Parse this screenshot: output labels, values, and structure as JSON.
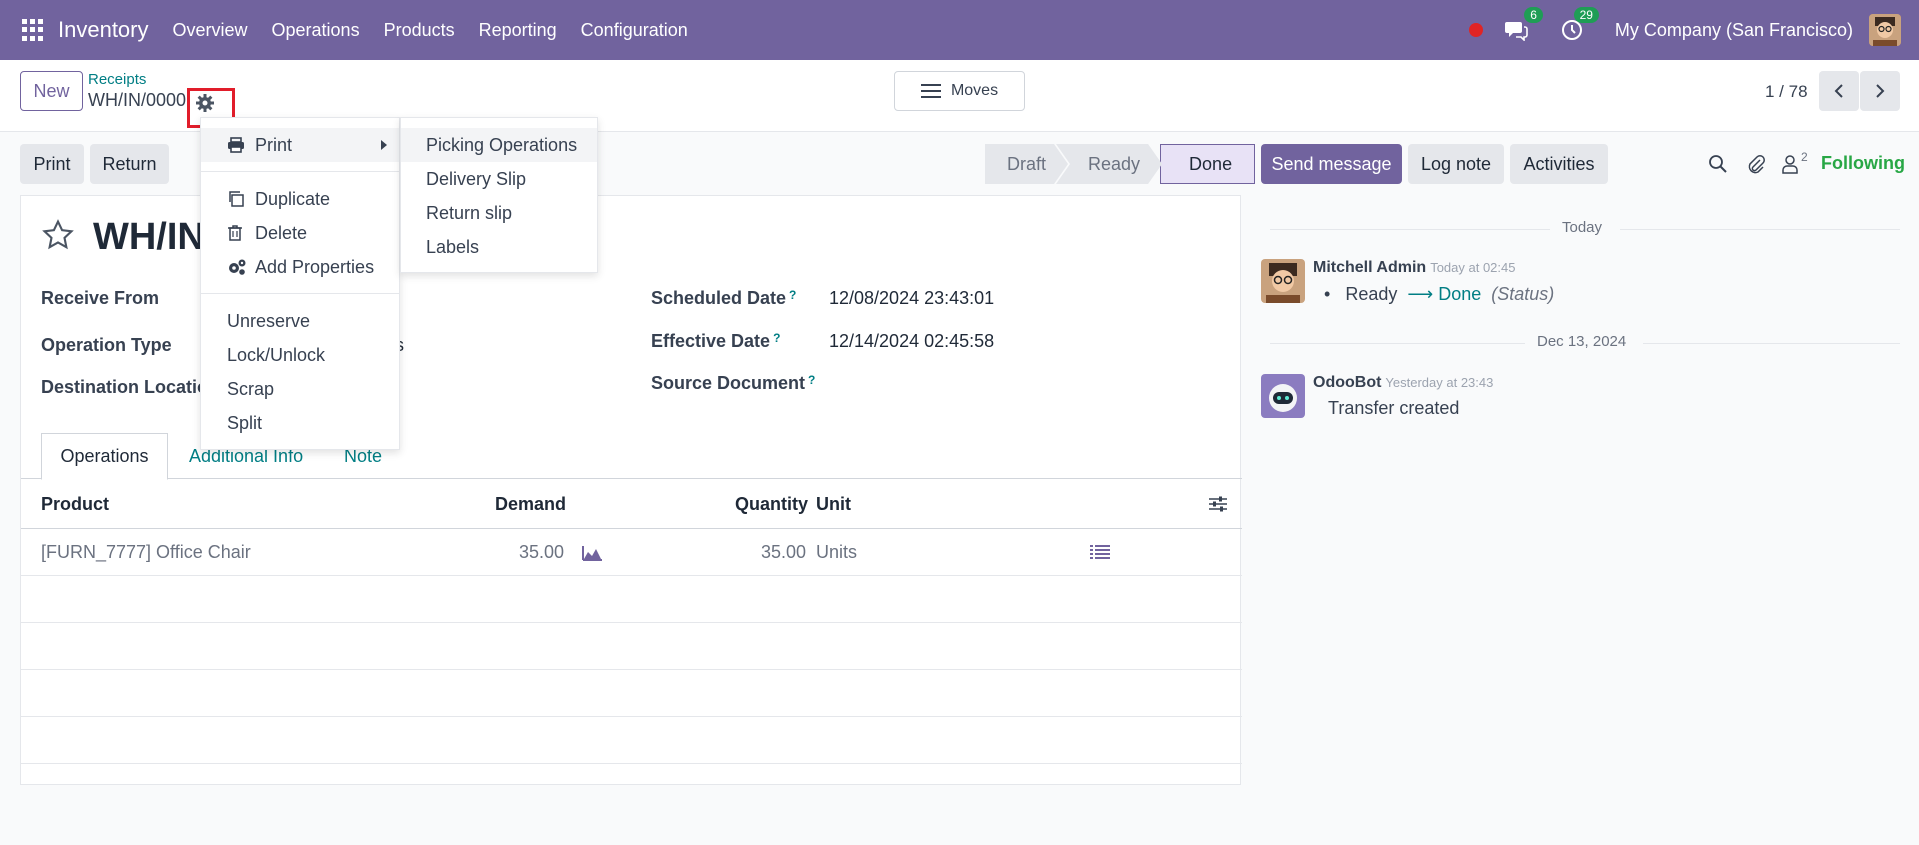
{
  "navbar": {
    "brand": "Inventory",
    "menu": [
      "Overview",
      "Operations",
      "Products",
      "Reporting",
      "Configuration"
    ],
    "chat_badge": "6",
    "activity_badge": "29",
    "company": "My Company (San Francisco)"
  },
  "control": {
    "new_label": "New",
    "breadcrumb_parent": "Receipts",
    "breadcrumb_current": "WH/IN/0000",
    "moves_label": "Moves",
    "pager": "1 / 78"
  },
  "actions": {
    "print": "Print",
    "return": "Return"
  },
  "status": {
    "steps": [
      "Draft",
      "Ready",
      "Done"
    ],
    "active": "Done"
  },
  "form": {
    "title": "WH/IN",
    "receive_from_label": "Receive From",
    "operation_type_label": "Operation Type",
    "operation_type_value_tail": "s",
    "destination_label": "Destination Locatior",
    "scheduled_date_label": "Scheduled Date",
    "scheduled_date_value": "12/08/2024 23:43:01",
    "effective_date_label": "Effective Date",
    "effective_date_value": "12/14/2024 02:45:58",
    "source_document_label": "Source Document",
    "help_mark": "?"
  },
  "tabs": [
    "Operations",
    "Additional Info",
    "Note"
  ],
  "table": {
    "headers": {
      "product": "Product",
      "demand": "Demand",
      "quantity": "Quantity",
      "unit": "Unit"
    },
    "rows": [
      {
        "product": "[FURN_7777] Office Chair",
        "demand": "35.00",
        "quantity": "35.00",
        "unit": "Units"
      }
    ]
  },
  "dropdown": {
    "print": "Print",
    "duplicate": "Duplicate",
    "delete": "Delete",
    "add_properties": "Add Properties",
    "unreserve": "Unreserve",
    "lock_unlock": "Lock/Unlock",
    "scrap": "Scrap",
    "split": "Split"
  },
  "print_submenu": [
    "Picking Operations",
    "Delivery Slip",
    "Return slip",
    "Labels"
  ],
  "chatter": {
    "send_message": "Send message",
    "log_note": "Log note",
    "activities": "Activities",
    "follower_count": "2",
    "following": "Following",
    "sep_today": "Today",
    "msg1": {
      "author": "Mitchell Admin",
      "time": "Today at 02:45",
      "from": "Ready",
      "to": "Done",
      "field": "(Status)"
    },
    "sep_date": "Dec 13, 2024",
    "msg2": {
      "author": "OdooBot",
      "time": "Yesterday at 23:43",
      "body": "Transfer created"
    }
  },
  "colors": {
    "brand": "#71639e",
    "accent": "#017e84",
    "following": "#28a745",
    "highlight": "#e11d2a"
  }
}
